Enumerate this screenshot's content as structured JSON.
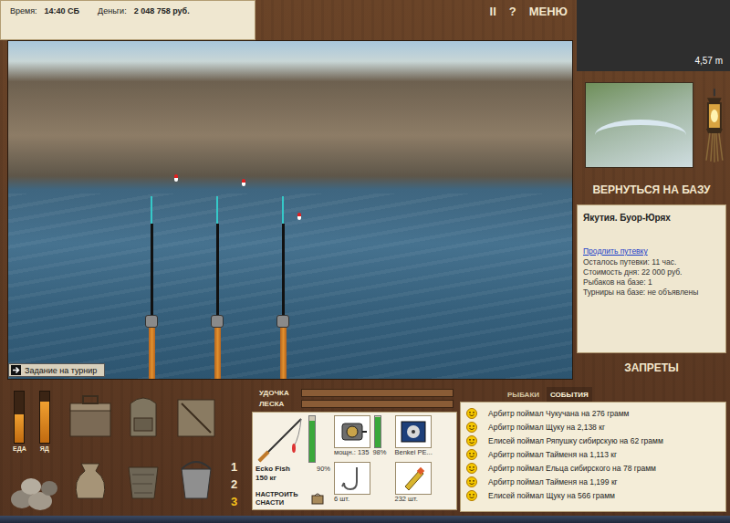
{
  "status": {
    "time_label": "Время:",
    "time": "14:40 СБ",
    "money_label": "Деньги:",
    "money": "2 048 758 руб."
  },
  "top_buttons": [
    "II",
    "?",
    "МЕНЮ"
  ],
  "depth": "4,57 m",
  "task_button": "Задание на турнир",
  "location": {
    "return_button": "ВЕРНУТЬСЯ НА БАЗУ",
    "name": "Якутия. Буор-Юрях",
    "extend_link": "Продлить путевку",
    "info": [
      "Осталось путевки: 11 час.",
      "Стоимость дня: 22 000 руб.",
      "Рыбаков на базе: 1",
      "Турниры на базе: не объявлены"
    ],
    "bans_button": "ЗАПРЕТЫ"
  },
  "needs": [
    {
      "label": "ЕДА",
      "level": 0.55
    },
    {
      "label": "ЯД",
      "level": 0.8
    }
  ],
  "slots": [
    {
      "label": "1",
      "selected": false
    },
    {
      "label": "2",
      "selected": false
    },
    {
      "label": "3",
      "selected": true
    }
  ],
  "gauges": [
    {
      "label": "УДОЧКА",
      "level": 0
    },
    {
      "label": "ЛЕСКА",
      "level": 0
    }
  ],
  "tackle": {
    "rod": {
      "name": "Ecko Fish",
      "strength": "150 кг",
      "condition": "90%",
      "level": 0.9
    },
    "reel": {
      "power": "мощн.: 135",
      "condition": "98%",
      "level": 0.98
    },
    "line": {
      "name": "Benkei PE..."
    },
    "hook": {
      "count": "6 шт."
    },
    "bait": {
      "count": "232 шт."
    },
    "setup_button": "НАСТРОИТЬ СНАСТИ"
  },
  "event_tabs": [
    {
      "label": "РЫБАКИ",
      "selected": false
    },
    {
      "label": "СОБЫТИЯ",
      "selected": true
    }
  ],
  "events": [
    "Арбитр поймал Чукучана на 276 грамм",
    "Арбитр поймал Щуку на 2,138 кг",
    "Елисей поймал Ряпушку сибирскую на 62 грамм",
    "Арбитр поймал Тайменя на 1,113 кг",
    "Арбитр поймал Ельца сибирского на 78 грамм",
    "Арбитр поймал Тайменя на 1,199 кг",
    "Елисей поймал Щуку на 566 грамм"
  ]
}
